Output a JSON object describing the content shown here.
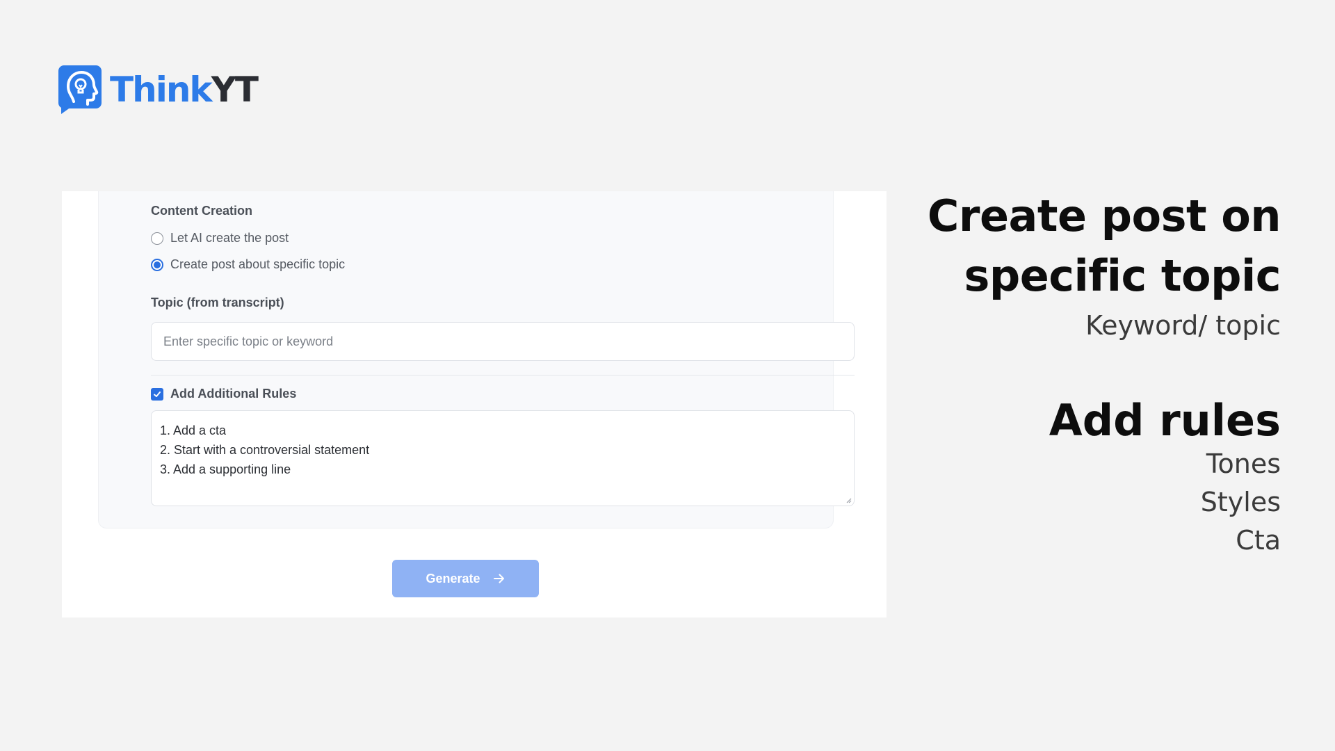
{
  "logo": {
    "text_part1": "Think",
    "text_part2": "YT",
    "icon": "head-lightbulb-icon",
    "colors": {
      "primary": "#2d7be8",
      "dark": "#2b2d33"
    }
  },
  "form": {
    "content_creation_label": "Content Creation",
    "options": [
      {
        "label": "Let AI create the post",
        "selected": false
      },
      {
        "label": "Create post about specific topic",
        "selected": true
      }
    ],
    "topic_label": "Topic (from transcript)",
    "topic_placeholder": "Enter specific topic or keyword",
    "topic_value": "",
    "rules_checkbox_label": "Add Additional Rules",
    "rules_checked": true,
    "rules_lines": [
      "1. Add a cta",
      "2. Start with a controversial statement",
      "3. Add a supporting line"
    ],
    "generate_label": "Generate",
    "generate_icon": "arrow-right-icon",
    "accent_color": "#2a6fe0",
    "button_color": "#8fb2f4"
  },
  "captions": {
    "title1_line1": "Create post on",
    "title1_line2": "specific topic",
    "subtitle1": "Keyword/ topic",
    "title2": "Add rules",
    "items": [
      "Tones",
      "Styles",
      "Cta"
    ]
  }
}
